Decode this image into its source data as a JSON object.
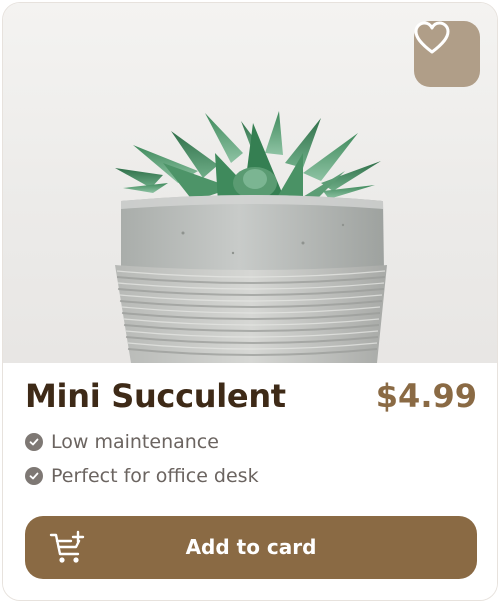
{
  "product": {
    "name": "Mini Succulent",
    "price": "$4.99",
    "image_subject": "succulent in grey concrete pot"
  },
  "features": [
    "Low maintenance",
    "Perfect for office desk"
  ],
  "actions": {
    "favorite_icon": "heart-icon",
    "add_label": "Add to card",
    "cart_icon": "cart-plus-icon"
  },
  "colors": {
    "accent": "#8a6a44",
    "favorite_bg": "#b09e88",
    "title": "#3e2a17",
    "text_muted": "#6b6460"
  }
}
